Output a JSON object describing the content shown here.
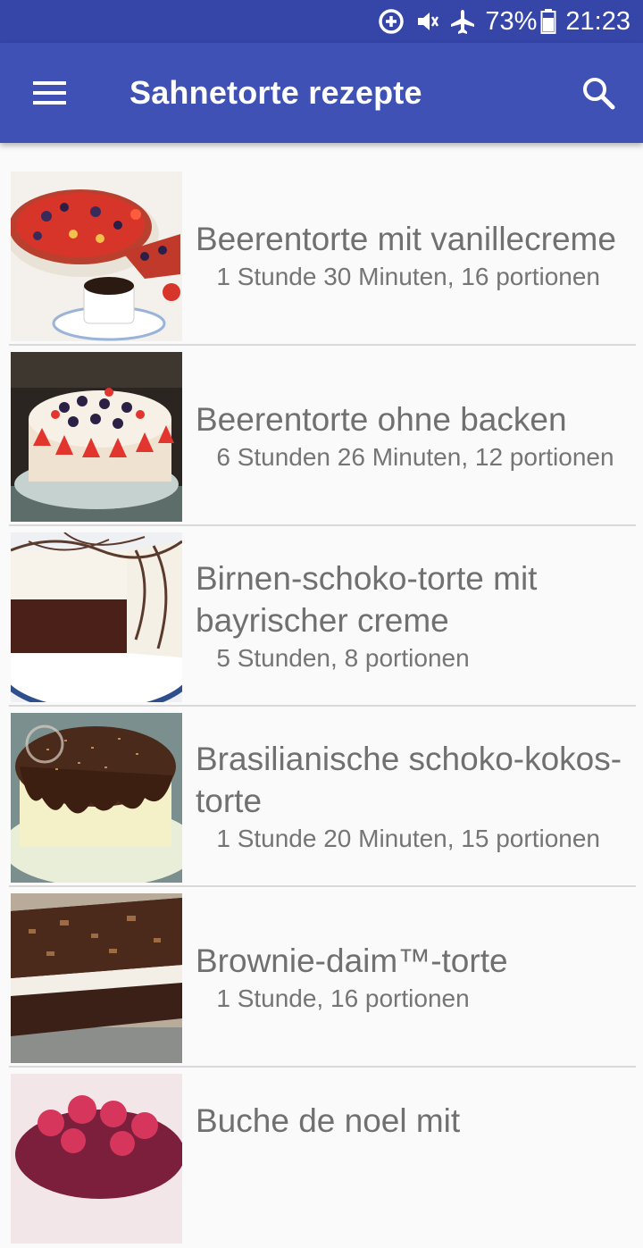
{
  "status_bar": {
    "battery": "73%",
    "time": "21:23",
    "icons": [
      "data-saver-icon",
      "mute-vibrate-icon",
      "airplane-icon",
      "battery-icon"
    ]
  },
  "app_bar": {
    "title": "Sahnetorte rezepte",
    "menu_icon": "hamburger-menu-icon",
    "search_icon": "search-icon"
  },
  "colors": {
    "status_bar": "#3646a8",
    "app_bar": "#3f51b5",
    "background": "#fafafa",
    "divider": "#d9d9d9",
    "text": "#757575"
  },
  "recipes": [
    {
      "title": "Beerentorte mit vanillecreme",
      "meta": "   1 Stunde 30 Minuten, 16 portionen"
    },
    {
      "title": "Beerentorte ohne backen",
      "meta": "   6 Stunden 26 Minuten, 12 portionen"
    },
    {
      "title": "Birnen-schoko-torte mit bayrischer creme",
      "meta": "   5 Stunden, 8 portionen"
    },
    {
      "title": "Brasilianische schoko-kokos-torte",
      "meta": "   1 Stunde 20 Minuten, 15 portionen"
    },
    {
      "title": "Brownie-daim™-torte",
      "meta": "   1 Stunde, 16 portionen"
    },
    {
      "title": "Buche de noel mit",
      "meta": ""
    }
  ]
}
